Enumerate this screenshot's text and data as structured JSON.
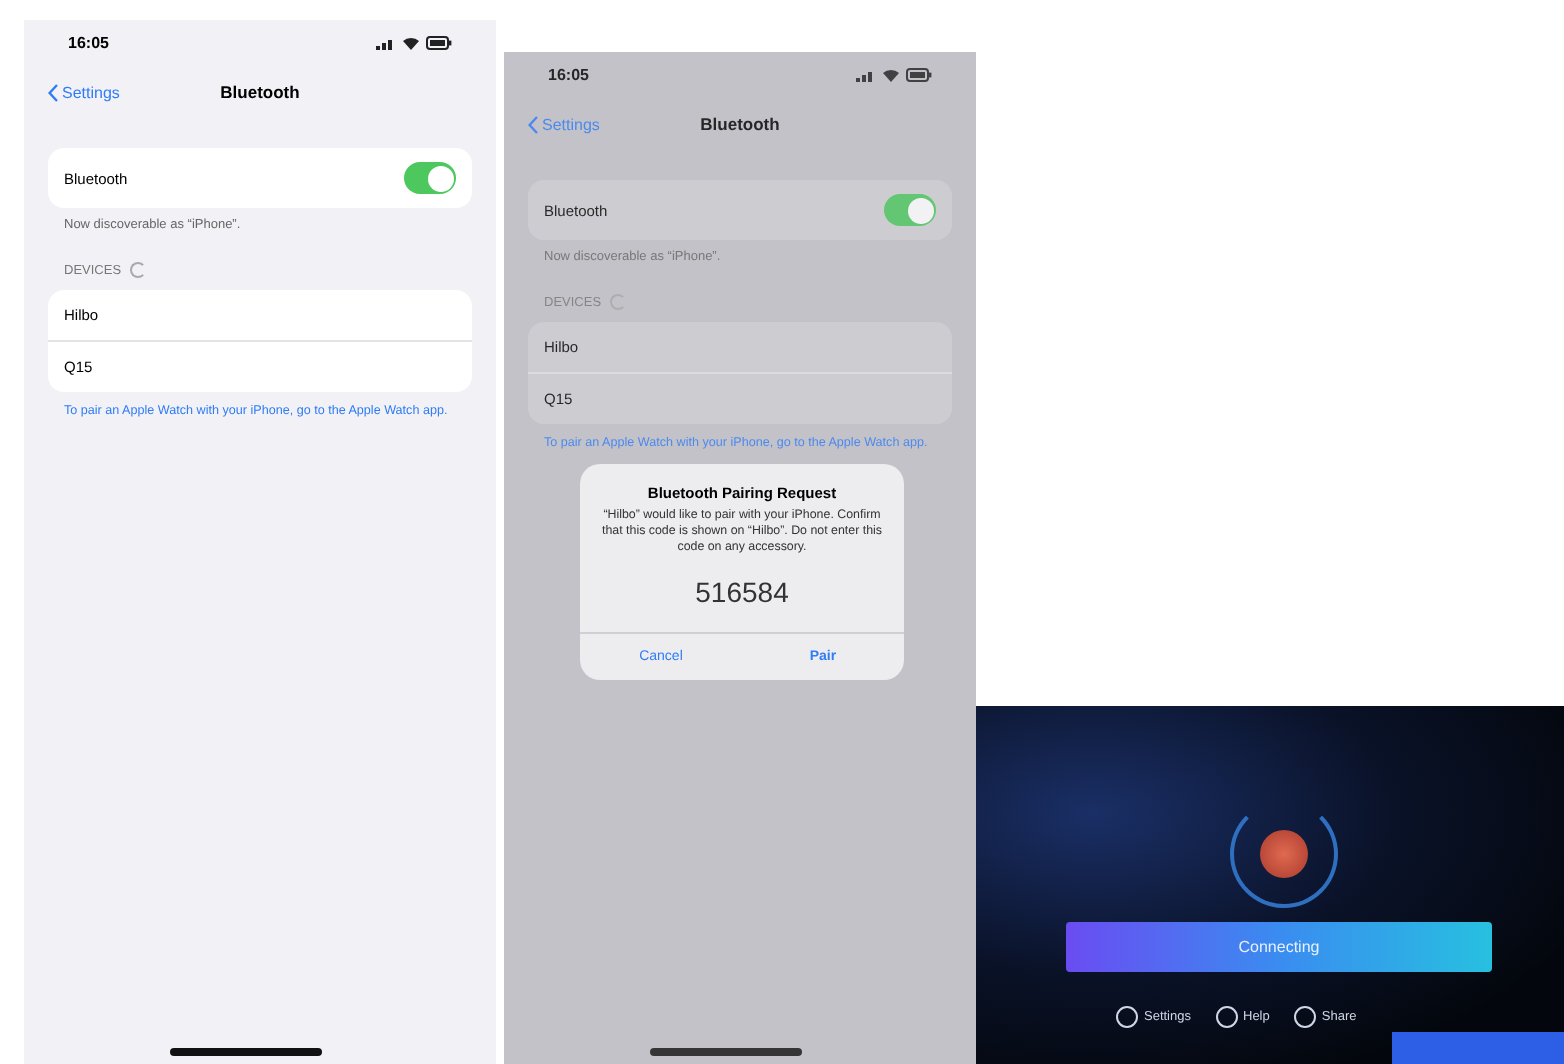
{
  "screens": [
    {
      "kind": "settings",
      "dimmed": false,
      "time": "16:05",
      "back": "Settings",
      "title": "Bluetooth",
      "toggle_label": "Bluetooth",
      "toggle_on": true,
      "note": "Now discoverable as “iPhone”.",
      "section": "DEVICES",
      "devices": [
        {
          "name": "Hilbo"
        },
        {
          "name": "Q15"
        }
      ],
      "footer": "To pair an Apple Watch with your iPhone, go to the Apple Watch app."
    },
    {
      "kind": "settings",
      "dimmed": true,
      "time": "16:05",
      "back": "Settings",
      "title": "Bluetooth",
      "toggle_label": "Bluetooth",
      "toggle_on": true,
      "note": "Now discoverable as “iPhone”.",
      "section": "DEVICES",
      "devices": [
        {
          "name": "Hilbo"
        },
        {
          "name": "Q15"
        }
      ],
      "footer": "To pair an Apple Watch with your iPhone, go to the Apple Watch app.",
      "dialog": {
        "title": "Bluetooth Pairing Request",
        "message": "“Hilbo” would like to pair with your iPhone. Confirm that this code is shown on “Hilbo”. Do not enter this code on any accessory.",
        "code": "516584",
        "buttons": [
          "Cancel",
          "Pair"
        ]
      }
    },
    {
      "kind": "app",
      "button": "Connecting",
      "nav": [
        {
          "label": "Settings"
        },
        {
          "label": "Help"
        },
        {
          "label": "Share"
        }
      ]
    }
  ]
}
